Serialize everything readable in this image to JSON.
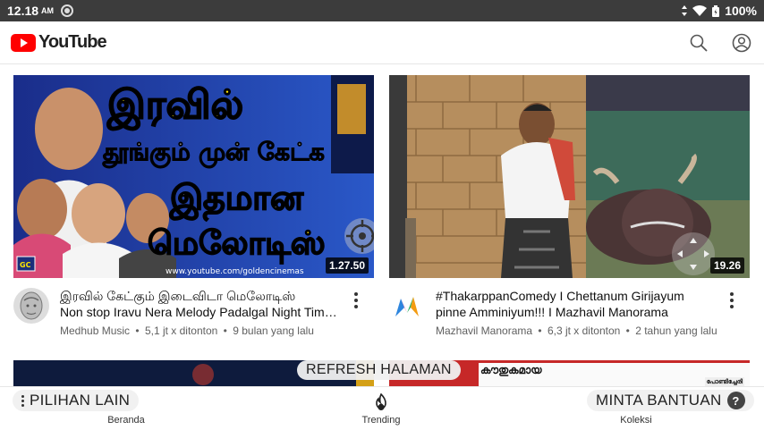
{
  "status_bar": {
    "time": "12.18",
    "ampm": "AM",
    "battery": "100%",
    "icons": [
      "screen-record-icon",
      "wifi-icon",
      "battery-icon"
    ]
  },
  "app_bar": {
    "logo_text": "YouTube",
    "icons": [
      "search-icon",
      "account-icon"
    ]
  },
  "videos": [
    {
      "thumb_text": {
        "line1": "இரவில்",
        "line2": "தூங்கும் முன் கேட்க",
        "line3": "இதமான",
        "line4": "மெலோடிஸ்",
        "url": "www.youtube.com/goldencinemas",
        "badge": "GC"
      },
      "duration": "1.27.50",
      "title_line1": "இரவில் கேட்கும் இடைவிடா மெலோடிஸ்",
      "title_line2": "Non stop Iravu Nera Melody Padalgal Night Tim…",
      "channel": "Medhub Music",
      "views": "5,1 jt x ditonton",
      "age": "9 bulan yang lalu"
    },
    {
      "duration": "19.26",
      "title_line1": "#ThakarppanComedy I Chettanum Girijayum",
      "title_line2": "pinne Amminiyum!!! I Mazhavil Manorama",
      "channel": "Mazhavil Manorama",
      "views": "6,3 jt x ditonton",
      "age": "2 tahun yang lalu"
    }
  ],
  "partial_thumb_text": "കൗതുകമായ",
  "partial_thumb_text2": "പോണ്ടിച്ചേരി",
  "overlays": {
    "refresh": "REFRESH HALAMAN",
    "more_options": "PILIHAN LAIN",
    "help": "MINTA BANTUAN",
    "help_icon": "?"
  },
  "bottom_nav": {
    "home": "Beranda",
    "trending": "Trending",
    "library": "Koleksi"
  },
  "separator": "•"
}
